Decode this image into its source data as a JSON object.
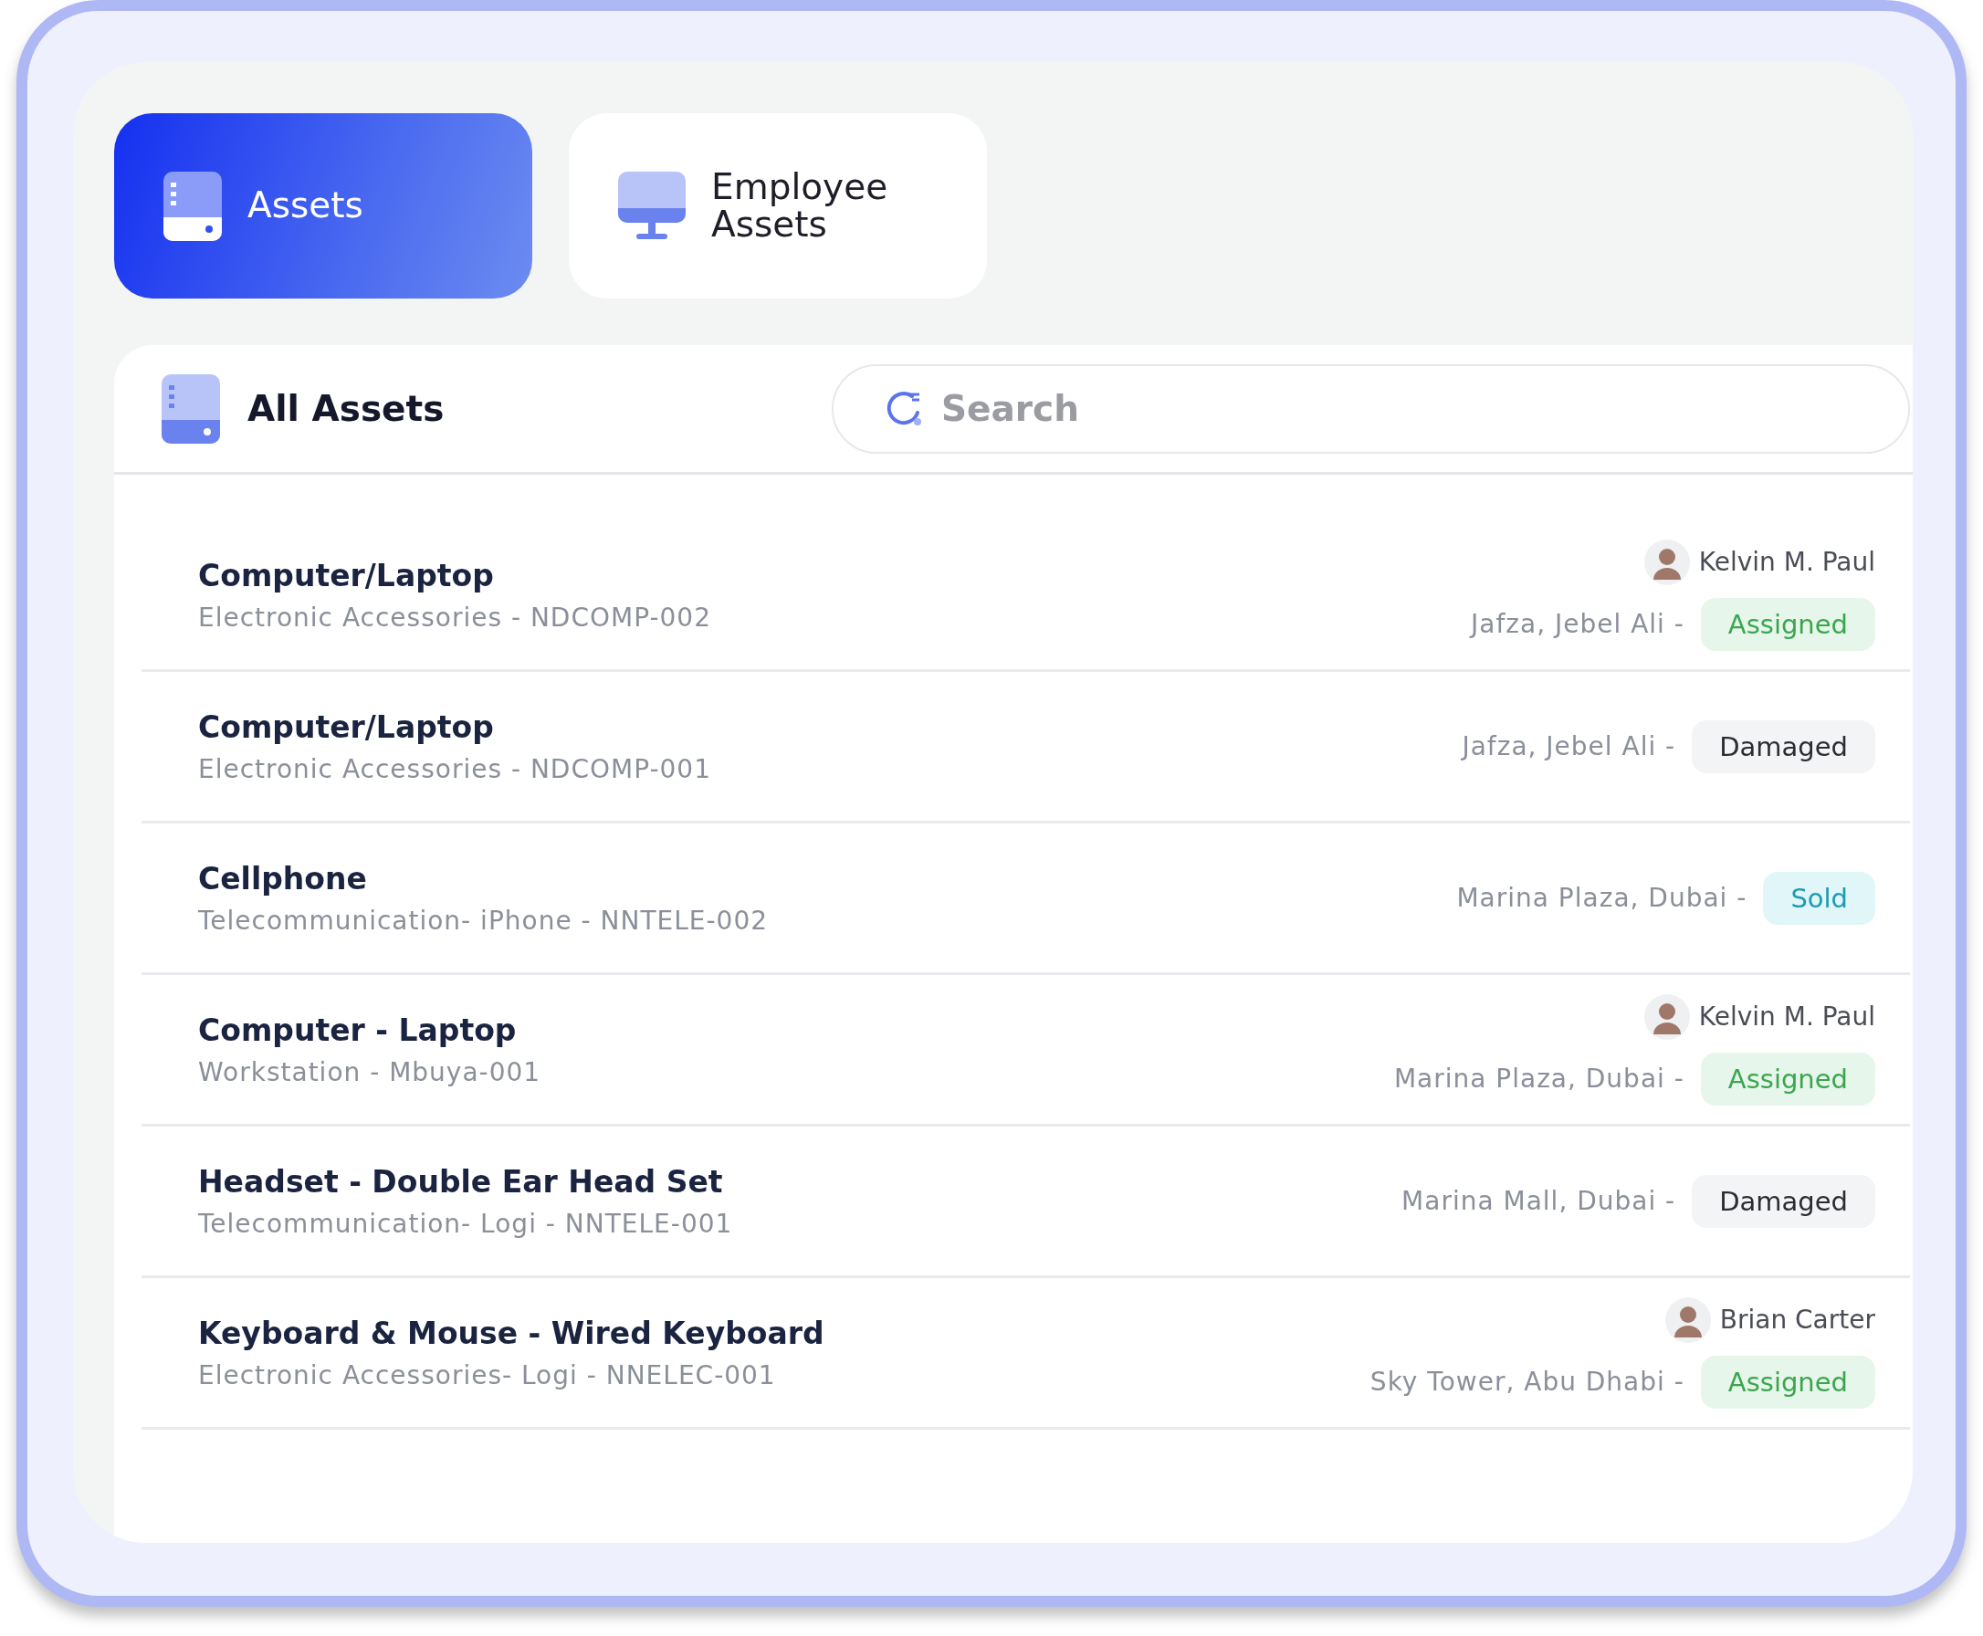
{
  "tabs": [
    {
      "label": "Assets",
      "selected": true,
      "kind": "drive"
    },
    {
      "label": "Employee Assets",
      "selected": false,
      "kind": "monitor"
    }
  ],
  "list_header": {
    "title": "All Assets"
  },
  "search": {
    "placeholder": "Search"
  },
  "assets": [
    {
      "name": "Computer/Laptop",
      "details": "Electronic Accessories - NDCOMP-002",
      "assignee": "Kelvin M. Paul",
      "location": "Jafza, Jebel Ali -",
      "status": {
        "label": "Assigned",
        "kind": "assigned"
      }
    },
    {
      "name": "Computer/Laptop",
      "details": "Electronic Accessories - NDCOMP-001",
      "location": "Jafza, Jebel Ali -",
      "status": {
        "label": "Damaged",
        "kind": "damaged"
      }
    },
    {
      "name": "Cellphone",
      "details": "Telecommunication- iPhone - NNTELE-002",
      "location": "Marina Plaza, Dubai -",
      "status": {
        "label": "Sold",
        "kind": "sold"
      }
    },
    {
      "name": "Computer - Laptop",
      "details": "Workstation - Mbuya-001",
      "assignee": "Kelvin M. Paul",
      "location": "Marina Plaza, Dubai -",
      "status": {
        "label": "Assigned",
        "kind": "assigned"
      }
    },
    {
      "name": "Headset - Double Ear Head Set",
      "details": "Telecommunication- Logi - NNTELE-001",
      "location": "Marina Mall, Dubai -",
      "status": {
        "label": "Damaged",
        "kind": "damaged"
      }
    },
    {
      "name": "Keyboard & Mouse - Wired Keyboard",
      "details": "Electronic Accessories- Logi - NNELEC-001",
      "assignee": "Brian Carter",
      "location": "Sky Tower, Abu Dhabi -",
      "status": {
        "label": "Assigned",
        "kind": "assigned"
      }
    }
  ]
}
